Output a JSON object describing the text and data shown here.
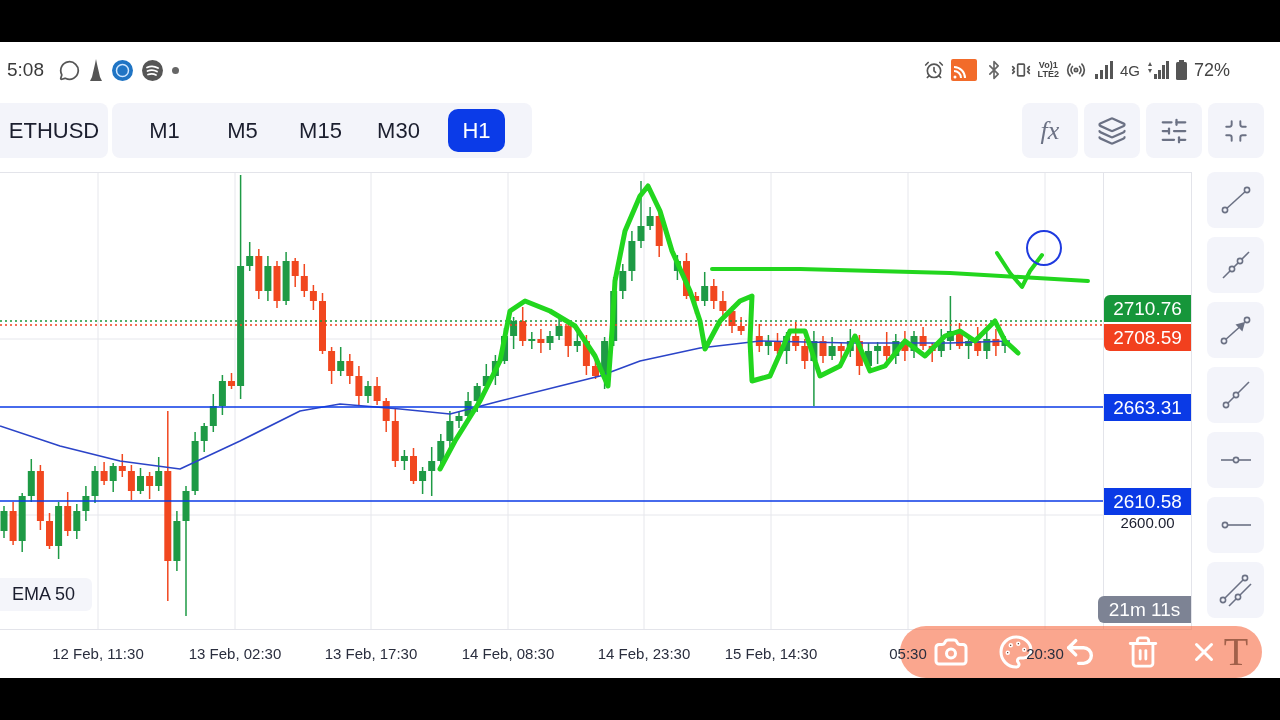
{
  "status_bar": {
    "time": "5:08",
    "volte": [
      "Vo)1",
      "LTE2"
    ],
    "network": "4G",
    "battery": "72%"
  },
  "toolbar": {
    "symbol": "ETHUSD",
    "timeframes": [
      {
        "label": "M1",
        "selected": false
      },
      {
        "label": "M5",
        "selected": false
      },
      {
        "label": "M15",
        "selected": false
      },
      {
        "label": "M30",
        "selected": false
      },
      {
        "label": "H1",
        "selected": true
      }
    ],
    "indicator_button": "fx"
  },
  "chart": {
    "price_tags": [
      {
        "value": "2710.76",
        "kind": "ask",
        "color": "#16963a"
      },
      {
        "value": "2708.59",
        "kind": "bid",
        "color": "#f2401e"
      },
      {
        "value": "2663.31",
        "kind": "level",
        "color": "#0a3ae6"
      },
      {
        "value": "2610.58",
        "kind": "level",
        "color": "#0a3ae6"
      }
    ],
    "price_label": "2600.00",
    "countdown": "21m 11s",
    "indicator_label": "EMA 50",
    "time_labels": [
      "12 Feb, 11:30",
      "13 Feb, 02:30",
      "13 Feb, 17:30",
      "14 Feb, 08:30",
      "14 Feb, 23:30",
      "15 Feb, 14:30",
      "05:30",
      "20:30"
    ]
  },
  "edit_bar": {
    "text_tool": "T"
  }
}
